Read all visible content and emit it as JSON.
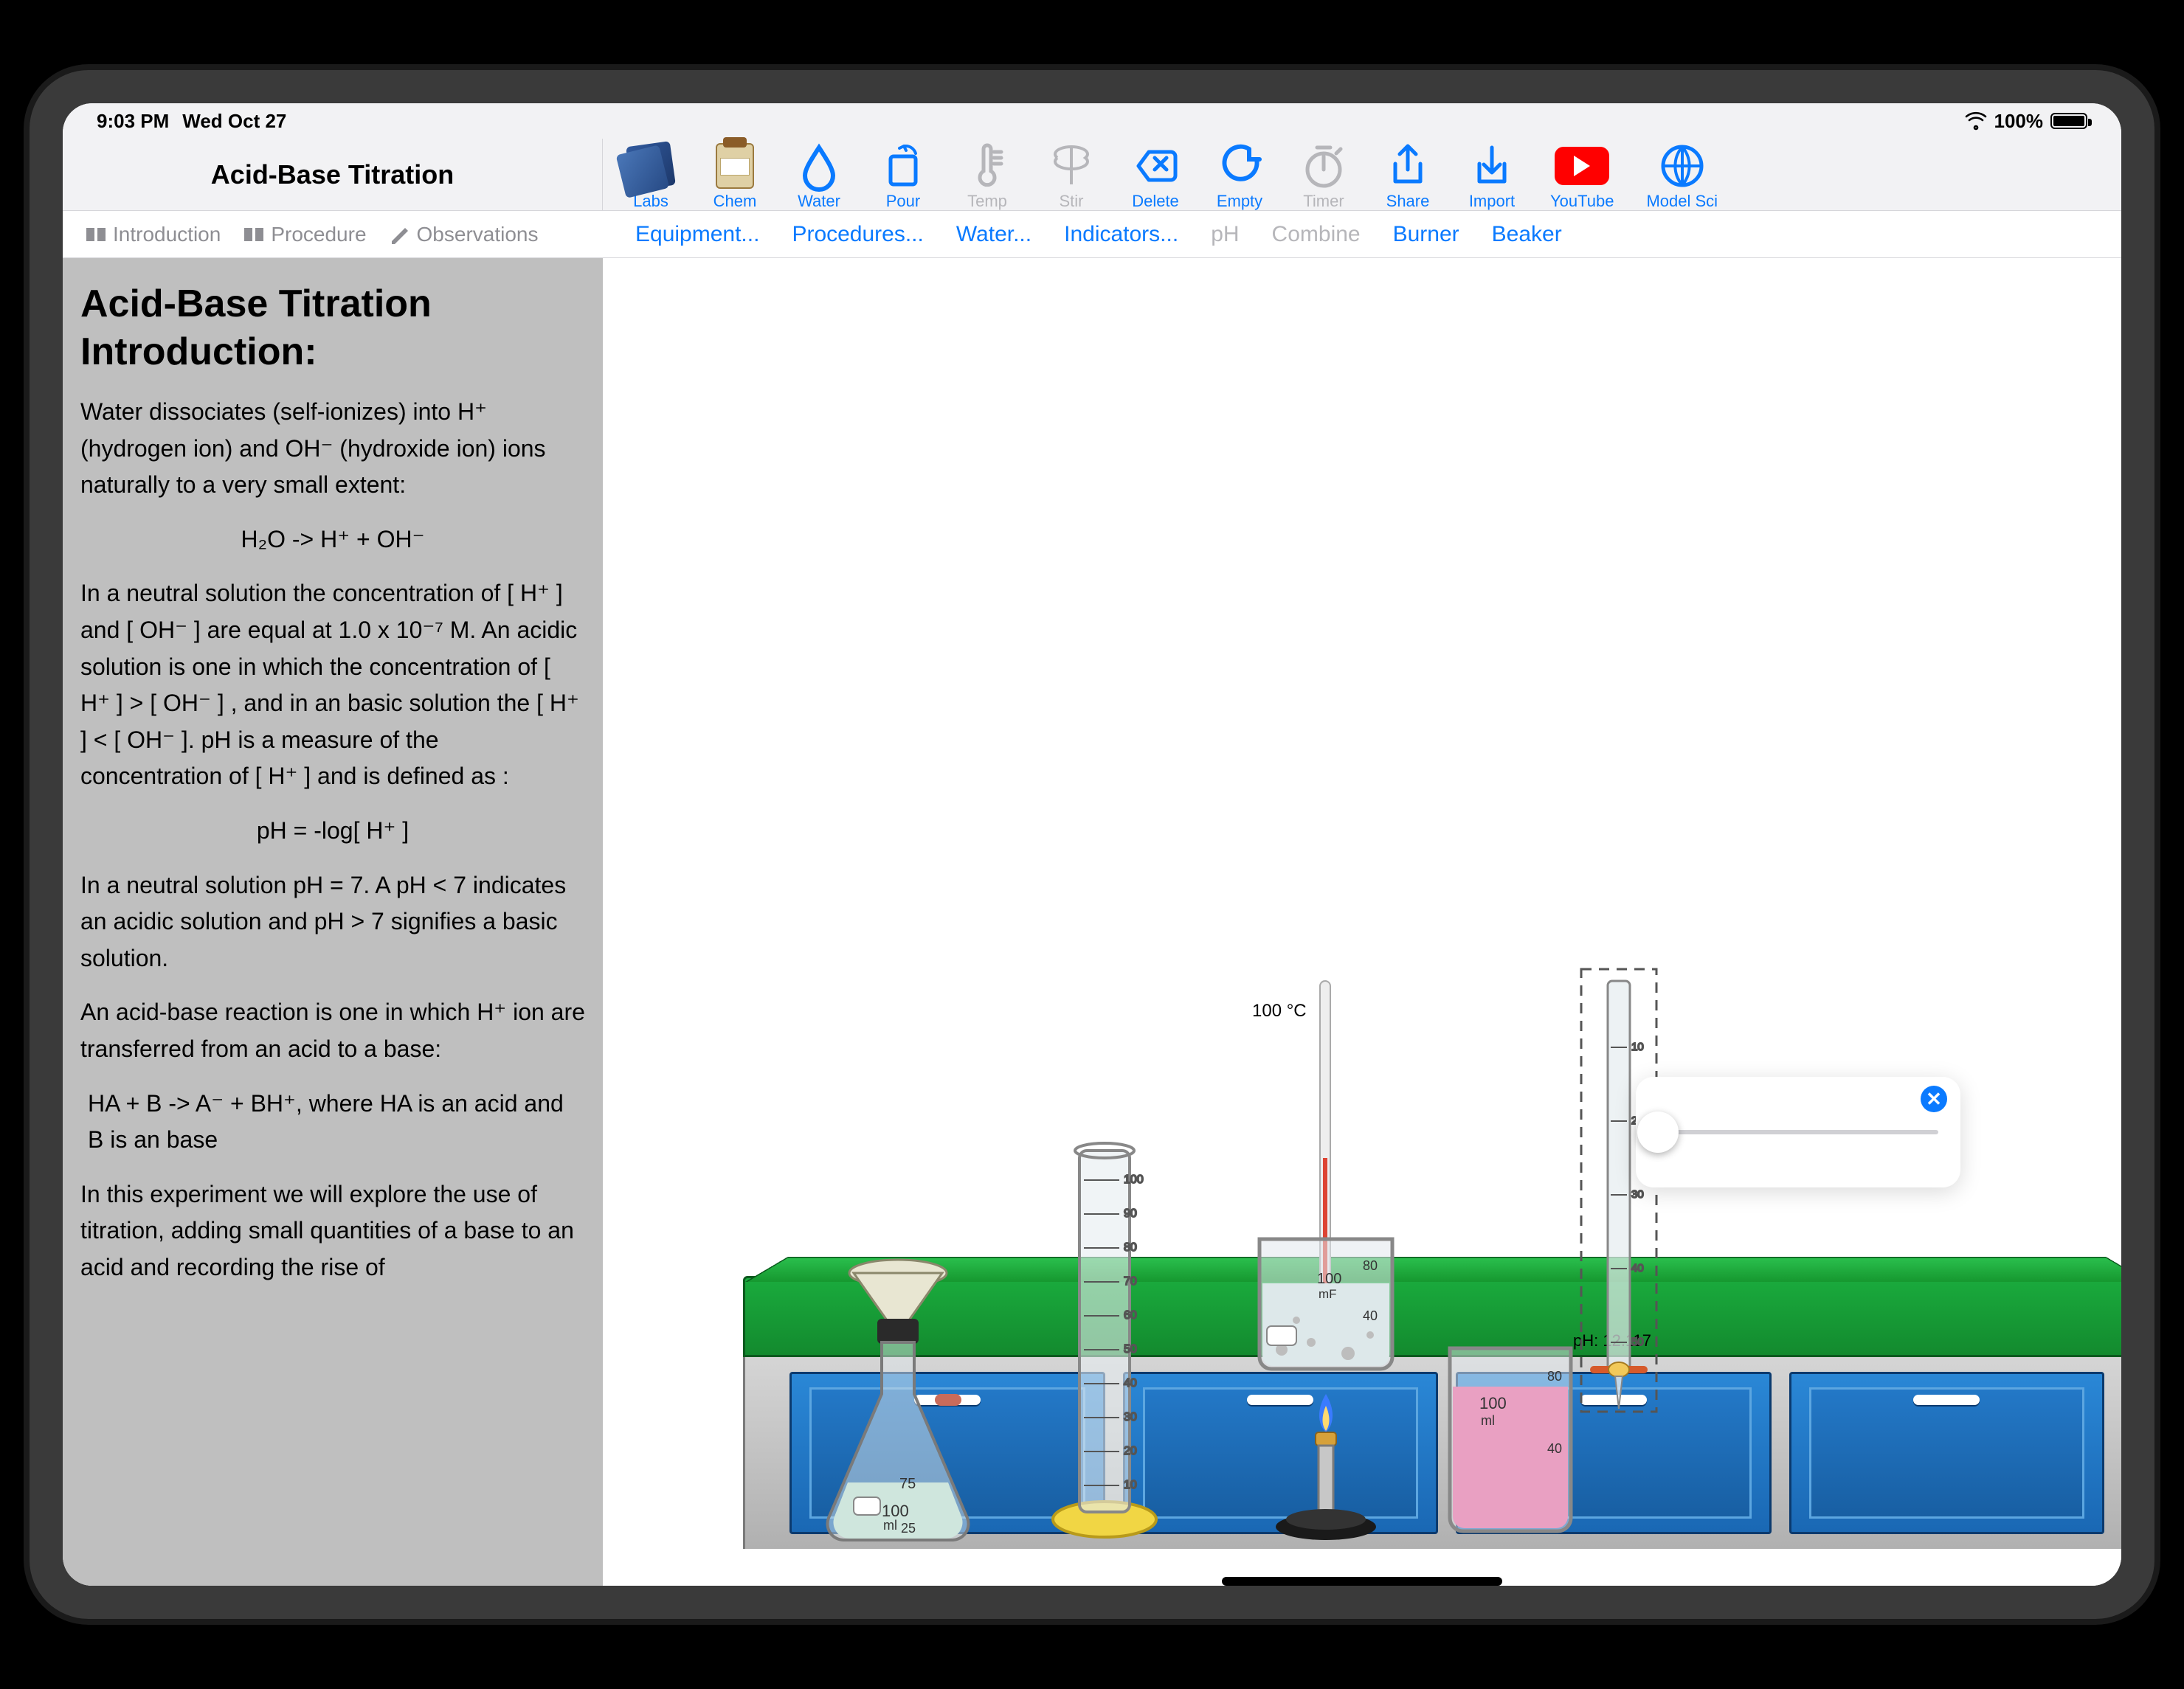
{
  "status": {
    "time": "9:03 PM",
    "date": "Wed Oct 27",
    "battery": "100%"
  },
  "title": "Acid-Base Titration",
  "tabs": {
    "intro": "Introduction",
    "proc": "Procedure",
    "obs": "Observations"
  },
  "toolbar": {
    "labs": "Labs",
    "chem": "Chem",
    "water": "Water",
    "pour": "Pour",
    "temp": "Temp",
    "stir": "Stir",
    "delete": "Delete",
    "empty": "Empty",
    "timer": "Timer",
    "share": "Share",
    "import": "Import",
    "youtube": "YouTube",
    "modelsci": "Model Sci"
  },
  "subbar": {
    "equipment": "Equipment...",
    "procedures": "Procedures...",
    "water": "Water...",
    "indicators": "Indicators...",
    "ph": "pH",
    "combine": "Combine",
    "burner": "Burner",
    "beaker": "Beaker"
  },
  "content": {
    "heading": "Acid-Base Titration Introduction:",
    "p1": "Water dissociates (self-ionizes) into H⁺ (hydrogen ion)  and OH⁻  (hydroxide ion) ions naturally to a  very small extent:",
    "eq1": "H₂O   ->   H⁺   +    OH⁻",
    "p2": "In a neutral solution  the concentration of [ H⁺ ] and [ OH⁻ ]  are equal at 1.0 x 10⁻⁷ M.  An acidic solution is one in which the concentration of  [ H⁺ ] >  [ OH⁻ ] , and in an basic solution the [ H⁺ ]  <  [ OH⁻ ].  pH is a measure of the concentration of [ H⁺ ] and is defined as :",
    "eq2": "pH = -log[ H⁺ ]",
    "p3": "In a neutral solution pH = 7.  A  pH < 7 indicates an acidic solution and pH > 7 signifies a basic solution.",
    "p4": "An acid-base reaction is one in which  H⁺ ion are transferred from an acid to a base:",
    "eq3": "HA  + B  ->   A⁻ +  BH⁺,    where HA is an acid and B is an base",
    "p5": "In this experiment we will explore the use of titration, adding small quantities of a base to an acid and recording the rise of"
  },
  "lab": {
    "temperature": "100 °C",
    "ph_readout": "pH: 12.117",
    "flask": {
      "volume": "100",
      "unit": "ml",
      "marks": [
        "75",
        "25"
      ]
    },
    "cylinder": {
      "marks": [
        "100",
        "90",
        "80",
        "70",
        "60",
        "50",
        "40",
        "30",
        "20",
        "10"
      ]
    },
    "beaker_heated": {
      "vol": "100",
      "unit": "mF",
      "marks": [
        "80",
        "40"
      ]
    },
    "beaker_pink": {
      "vol": "100",
      "unit": "ml",
      "marks": [
        "80",
        "40"
      ]
    },
    "burette": {
      "marks": [
        "10",
        "20",
        "30",
        "40",
        "50"
      ]
    }
  }
}
